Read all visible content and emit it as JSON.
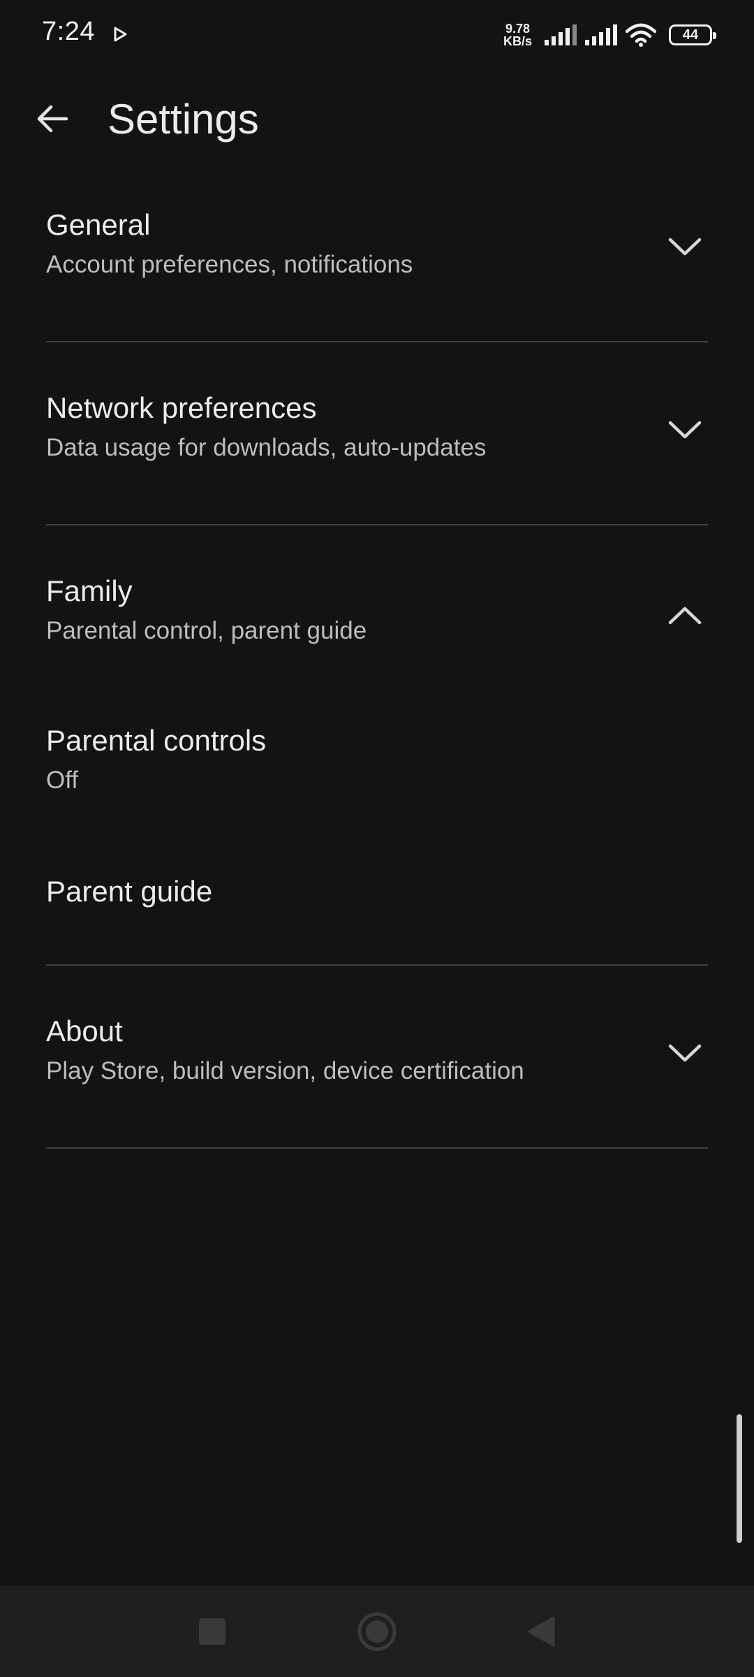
{
  "status_bar": {
    "time": "7:24",
    "net_speed_value": "9.78",
    "net_speed_unit": "KB/s",
    "battery": "44",
    "icons": [
      "play-store-icon",
      "signal-icon",
      "signal-icon",
      "wifi-icon",
      "battery-icon"
    ]
  },
  "app_bar": {
    "back_icon": "arrow-back-icon",
    "title": "Settings"
  },
  "sections": [
    {
      "title": "General",
      "subtitle": "Account preferences, notifications",
      "expanded": false
    },
    {
      "title": "Network preferences",
      "subtitle": "Data usage for downloads, auto-updates",
      "expanded": false
    },
    {
      "title": "Family",
      "subtitle": "Parental control, parent guide",
      "expanded": true,
      "children": [
        {
          "title": "Parental controls",
          "subtitle": "Off"
        },
        {
          "title": "Parent guide"
        }
      ]
    },
    {
      "title": "About",
      "subtitle": "Play Store, build version, device certification",
      "expanded": false
    }
  ],
  "nav_bar": {
    "icons": [
      "recents-square-icon",
      "home-circle-icon",
      "back-triangle-icon"
    ]
  },
  "colors": {
    "background": "#131313",
    "text_primary": "#ececec",
    "text_secondary": "#bdbdbd",
    "divider": "#3f3f3f",
    "nav_background": "#1f1f21"
  }
}
